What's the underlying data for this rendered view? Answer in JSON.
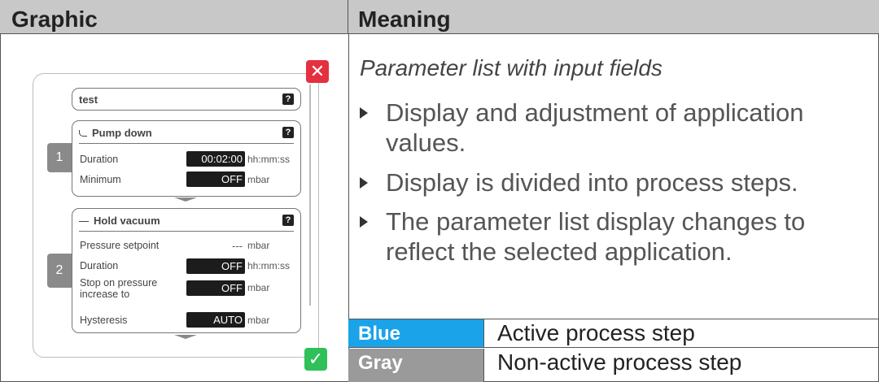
{
  "table": {
    "header_graphic": "Graphic",
    "header_meaning": "Meaning"
  },
  "device": {
    "test_box": {
      "title": "test",
      "help": "?"
    },
    "step1": {
      "number": "1",
      "title": "Pump down",
      "help": "?",
      "rows": [
        {
          "label": "Duration",
          "value": "00:02:00",
          "unit": "hh:mm:ss"
        },
        {
          "label": "Minimum",
          "value": "OFF",
          "unit": "mbar"
        }
      ]
    },
    "step2": {
      "number": "2",
      "title": "Hold vacuum",
      "help": "?",
      "rows": [
        {
          "label": "Pressure setpoint",
          "value": "---",
          "unit": "mbar"
        },
        {
          "label": "Duration",
          "value": "OFF",
          "unit": "hh:mm:ss"
        },
        {
          "label": "Stop on pressure increase to",
          "value": "OFF",
          "unit": "mbar"
        },
        {
          "label": "Hysteresis",
          "value": "AUTO",
          "unit": "mbar"
        }
      ]
    },
    "colors": {
      "close": "#e4303f",
      "confirm": "#2fc05a",
      "step_number": "#8a8a8a"
    }
  },
  "meaning": {
    "title": "Parameter list with input fields",
    "bullets": [
      "Display and adjustment of application values.",
      "Display is divided into process steps.",
      "The parameter list display changes to reflect the selected application."
    ],
    "legend": [
      {
        "key": "Blue",
        "value": "Active process step",
        "color": "#1aa3e8"
      },
      {
        "key": "Gray",
        "value": "Non-active process step",
        "color": "#9a9a9a"
      }
    ]
  }
}
